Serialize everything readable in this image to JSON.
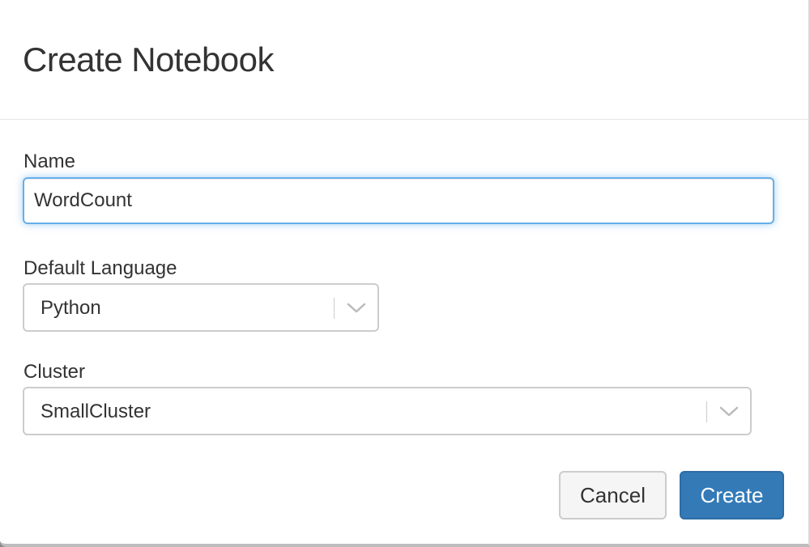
{
  "dialog": {
    "title": "Create Notebook"
  },
  "form": {
    "name": {
      "label": "Name",
      "value": "WordCount"
    },
    "language": {
      "label": "Default Language",
      "selected": "Python"
    },
    "cluster": {
      "label": "Cluster",
      "selected": "SmallCluster"
    }
  },
  "buttons": {
    "cancel_label": "Cancel",
    "create_label": "Create"
  },
  "colors": {
    "primary": "#337ab7",
    "focus_border": "#66afe9",
    "text": "#333333"
  },
  "icons": {
    "dropdown": "chevron-down-icon"
  }
}
